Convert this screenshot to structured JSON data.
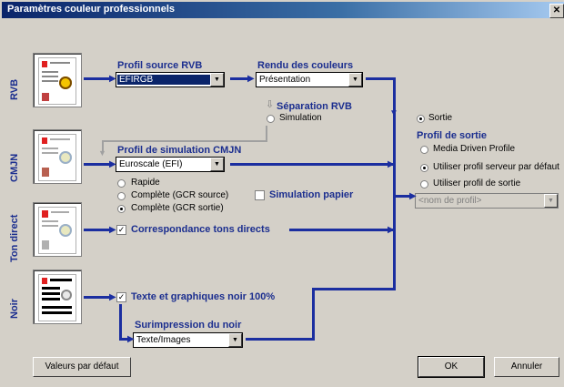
{
  "window": {
    "title": "Paramètres couleur professionnels"
  },
  "rows": {
    "rvb": "RVB",
    "cmjn": "CMJN",
    "ton_direct": "Ton direct",
    "noir": "Noir"
  },
  "profil_source": {
    "label": "Profil source RVB",
    "value": "EFIRGB"
  },
  "rendu": {
    "label": "Rendu des couleurs",
    "value": "Présentation"
  },
  "separation": {
    "label": "Séparation RVB",
    "simulation": "Simulation",
    "sortie": "Sortie",
    "selected": "Sortie"
  },
  "simulation_cmjn": {
    "label": "Profil de simulation CMJN",
    "value": "Euroscale (EFI)",
    "options": [
      "Rapide",
      "Complète (GCR source)",
      "Complète (GCR sortie)"
    ],
    "selected": "Complète (GCR sortie)"
  },
  "simulation_papier": {
    "label": "Simulation papier",
    "checked": false
  },
  "tons_directs": {
    "label": "Correspondance tons directs",
    "checked": true
  },
  "noir_100": {
    "label": "Texte et graphiques noir 100%",
    "checked": true
  },
  "surimpression": {
    "label": "Surimpression du noir",
    "value": "Texte/Images"
  },
  "profil_sortie": {
    "label": "Profil de sortie",
    "options": [
      "Media Driven Profile",
      "Utiliser profil serveur par défaut",
      "Utiliser profil de sortie"
    ],
    "selected": "Utiliser profil serveur par défaut",
    "placeholder": "<nom de profil>"
  },
  "buttons": {
    "defaults": "Valeurs par défaut",
    "ok": "OK",
    "cancel": "Annuler"
  },
  "colors": {
    "accent": "#1b2e8f",
    "title_bar": "#0a246a",
    "background": "#d4d0c8"
  }
}
